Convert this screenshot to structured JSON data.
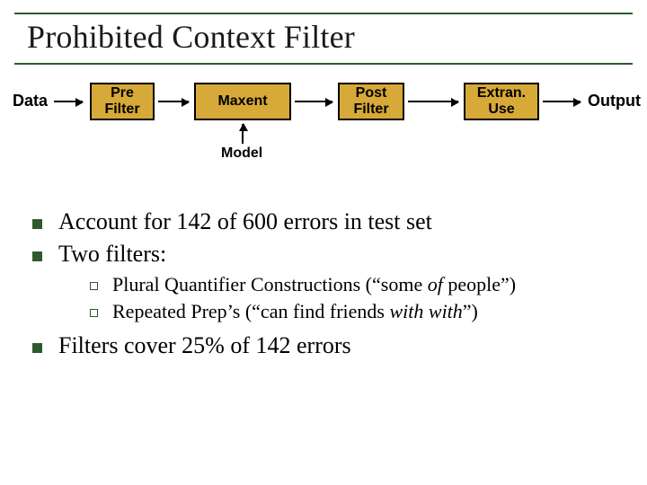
{
  "title": "Prohibited Context Filter",
  "pipeline": {
    "data_label": "Data",
    "pre_filter": "Pre\nFilter",
    "maxent": "Maxent",
    "post_filter": "Post\nFilter",
    "extran_use": "Extran.\nUse",
    "output_label": "Output",
    "model_label": "Model"
  },
  "bullets": {
    "b1": "Account for 142 of 600 errors in test set",
    "b2": "Two filters:",
    "b2_sub1_pre": "Plural Quantifier Constructions (“some ",
    "b2_sub1_em": "of",
    "b2_sub1_post": " people”)",
    "b2_sub2_pre": "Repeated Prep’s (“can find friends ",
    "b2_sub2_em": "with with",
    "b2_sub2_post": "”)",
    "b3": "Filters cover 25% of 142 errors"
  }
}
